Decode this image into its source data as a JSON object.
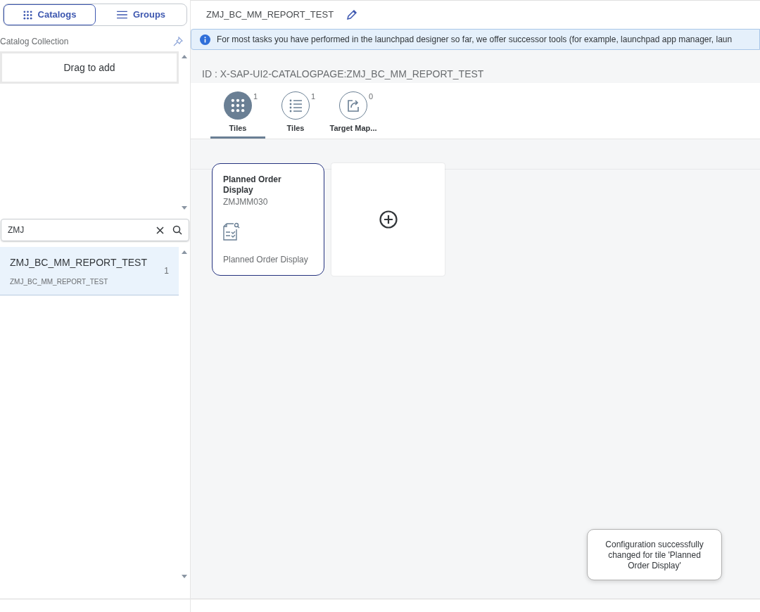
{
  "sidebar": {
    "toggle": [
      {
        "label": "Catalogs",
        "kind": "grid",
        "selected": true
      },
      {
        "label": "Groups",
        "kind": "list",
        "selected": false
      }
    ],
    "collection_title": "Catalog Collection",
    "drop_zone": "Drag to add",
    "search": {
      "value": "ZMJ"
    },
    "results": [
      {
        "title": "ZMJ_BC_MM_REPORT_TEST",
        "subtitle": "ZMJ_BC_MM_REPORT_TEST",
        "count": "1",
        "selected": true
      }
    ]
  },
  "header": {
    "title": "ZMJ_BC_MM_REPORT_TEST"
  },
  "info_strip": "For most tasks you have performed in the launchpad designer so far, we offer successor tools (for example, launchpad app manager, laun",
  "catalog_id": "ID : X-SAP-UI2-CATALOGPAGE:ZMJ_BC_MM_REPORT_TEST",
  "icon_tabs": [
    {
      "label": "Tiles",
      "count": "1",
      "kind": "grid",
      "selected": true
    },
    {
      "label": "Tiles",
      "count": "1",
      "kind": "list",
      "selected": false
    },
    {
      "label": "Target Map...",
      "count": "0",
      "kind": "share",
      "selected": false
    }
  ],
  "tiles": [
    {
      "kind": "app",
      "title": "Planned Order Display",
      "subtitle": "ZMJMM030",
      "footer": "Planned Order Display"
    },
    {
      "kind": "add"
    }
  ],
  "toast": "Configuration successfully changed for tile 'Planned Order Display'"
}
